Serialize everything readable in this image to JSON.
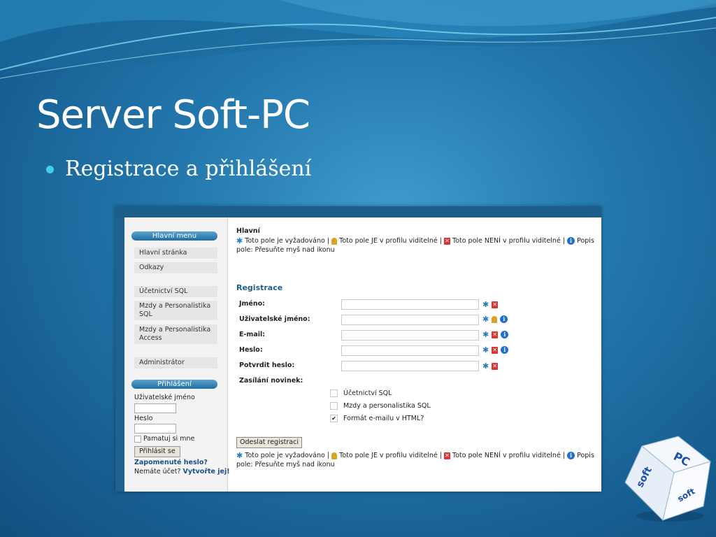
{
  "slide": {
    "title": "Server Soft-PC",
    "bullet": "Registrace a přihlášení"
  },
  "sidebar": {
    "menu_heading": "Hlavní menu",
    "items": [
      "Hlavní stránka",
      "Odkazy",
      "Účetnictví SQL",
      "Mzdy a Personalistika SQL",
      "Mzdy a Personalistika Access",
      "Administrátor"
    ],
    "login_heading": "Přihlášení",
    "username_label": "Uživatelské jméno",
    "password_label": "Heslo",
    "remember_label": "Pamatuj si mne",
    "login_button": "Přihlásit se",
    "forgot_link": "Zapomenuté heslo?",
    "no_account_text": "Nemáte účet?",
    "create_link": "Vytvořte jej!"
  },
  "main": {
    "page_heading": "Hlavní",
    "legend": {
      "required": "Toto pole je vyžadováno |",
      "visible": "Toto pole JE v profilu viditelné |",
      "not_visible": "Toto pole NENÍ v profilu viditelné |",
      "description": "Popis pole: Přesuňte myš nad ikonu"
    },
    "section_title": "Registrace",
    "fields": [
      {
        "label": "Jméno:",
        "value": "",
        "icons": [
          "required-icon",
          "not-visible-icon"
        ]
      },
      {
        "label": "Uživatelské jméno:",
        "value": "",
        "icons": [
          "required-icon",
          "visible-icon",
          "info-icon"
        ]
      },
      {
        "label": "E-mail:",
        "value": "",
        "icons": [
          "required-icon",
          "not-visible-icon",
          "info-icon"
        ]
      },
      {
        "label": "Heslo:",
        "value": "",
        "icons": [
          "required-icon",
          "not-visible-icon",
          "info-icon"
        ]
      },
      {
        "label": "Potvrdit heslo:",
        "value": "",
        "icons": [
          "required-icon",
          "not-visible-icon"
        ]
      }
    ],
    "newsletter_label": "Zasílání novinek:",
    "newsletter_options": [
      {
        "label": "Účetnictví SQL",
        "checked": false
      },
      {
        "label": "Mzdy a personalistika SQL",
        "checked": false
      },
      {
        "label": "Formát e-mailu v HTML?",
        "checked": true
      }
    ],
    "submit_button": "Odeslat registraci"
  },
  "logo": {
    "text_soft": "soft",
    "text_pc": "PC"
  },
  "colors": {
    "background": "#2479ae",
    "accent": "#3fd0e8",
    "section_title": "#1e5d8c",
    "menu_heading": "#1f6ea0"
  }
}
